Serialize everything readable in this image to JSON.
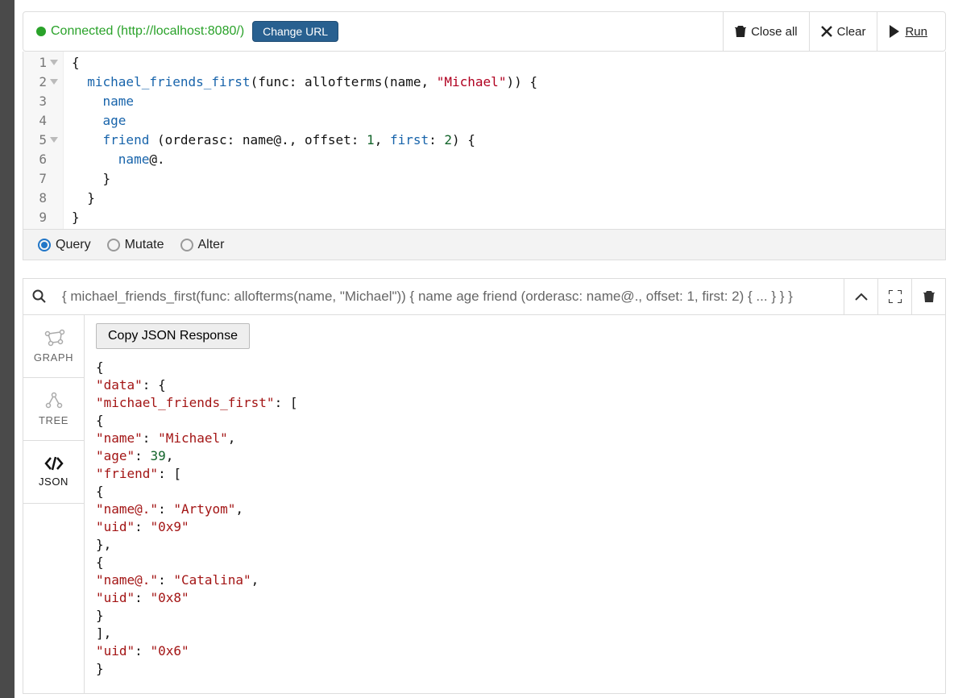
{
  "topbar": {
    "connection_label": "Connected (http://localhost:8080/)",
    "change_url_label": "Change URL",
    "close_all_label": "Close all",
    "clear_label": "Clear",
    "run_label": "Run"
  },
  "editor": {
    "lines": [
      "1",
      "2",
      "3",
      "4",
      "5",
      "6",
      "7",
      "8",
      "9"
    ],
    "code_tokens": [
      [
        {
          "t": "{",
          "c": "k-d"
        }
      ],
      [
        {
          "t": "  ",
          "c": ""
        },
        {
          "t": "michael_friends_first",
          "c": "k-blue"
        },
        {
          "t": "(func: allofterms(name, ",
          "c": "k-pl"
        },
        {
          "t": "\"Michael\"",
          "c": "k-str"
        },
        {
          "t": ")) {",
          "c": "k-pl"
        }
      ],
      [
        {
          "t": "    ",
          "c": ""
        },
        {
          "t": "name",
          "c": "k-nm"
        }
      ],
      [
        {
          "t": "    ",
          "c": ""
        },
        {
          "t": "age",
          "c": "k-nm"
        }
      ],
      [
        {
          "t": "    ",
          "c": ""
        },
        {
          "t": "friend",
          "c": "k-nm"
        },
        {
          "t": " (orderasc: name@., offset: ",
          "c": "k-pl"
        },
        {
          "t": "1",
          "c": "k-num"
        },
        {
          "t": ", ",
          "c": "k-pl"
        },
        {
          "t": "first",
          "c": "k-nm"
        },
        {
          "t": ": ",
          "c": "k-pl"
        },
        {
          "t": "2",
          "c": "k-num"
        },
        {
          "t": ") {",
          "c": "k-pl"
        }
      ],
      [
        {
          "t": "      ",
          "c": ""
        },
        {
          "t": "name",
          "c": "k-nm"
        },
        {
          "t": "@.",
          "c": "k-pl"
        }
      ],
      [
        {
          "t": "    }",
          "c": "k-d"
        }
      ],
      [
        {
          "t": "  }",
          "c": "k-d"
        }
      ],
      [
        {
          "t": "}",
          "c": "k-d"
        }
      ]
    ]
  },
  "modes": {
    "query": "Query",
    "mutate": "Mutate",
    "alter": "Alter",
    "selected": "query"
  },
  "history": {
    "summary": "{ michael_friends_first(func: allofterms(name, \"Michael\")) { name age friend (orderasc: name@., offset: 1, first: 2) { ... } } }"
  },
  "sidetabs": {
    "graph": "GRAPH",
    "tree": "TREE",
    "json": "JSON"
  },
  "result": {
    "copy_label": "Copy JSON Response",
    "json_lines": [
      [
        {
          "t": "{",
          "c": "jp"
        }
      ],
      [
        {
          "t": "  ",
          "c": ""
        },
        {
          "t": "\"data\"",
          "c": "jk"
        },
        {
          "t": ": {",
          "c": "jp"
        }
      ],
      [
        {
          "t": "    ",
          "c": ""
        },
        {
          "t": "\"michael_friends_first\"",
          "c": "jk"
        },
        {
          "t": ": [",
          "c": "jp"
        }
      ],
      [
        {
          "t": "      {",
          "c": "jp"
        }
      ],
      [
        {
          "t": "        ",
          "c": ""
        },
        {
          "t": "\"name\"",
          "c": "jk"
        },
        {
          "t": ": ",
          "c": "jp"
        },
        {
          "t": "\"Michael\"",
          "c": "js"
        },
        {
          "t": ",",
          "c": "jp"
        }
      ],
      [
        {
          "t": "        ",
          "c": ""
        },
        {
          "t": "\"age\"",
          "c": "jk"
        },
        {
          "t": ": ",
          "c": "jp"
        },
        {
          "t": "39",
          "c": "jn"
        },
        {
          "t": ",",
          "c": "jp"
        }
      ],
      [
        {
          "t": "        ",
          "c": ""
        },
        {
          "t": "\"friend\"",
          "c": "jk"
        },
        {
          "t": ": [",
          "c": "jp"
        }
      ],
      [
        {
          "t": "          {",
          "c": "jp"
        }
      ],
      [
        {
          "t": "            ",
          "c": ""
        },
        {
          "t": "\"name@.\"",
          "c": "jk"
        },
        {
          "t": ": ",
          "c": "jp"
        },
        {
          "t": "\"Artyom\"",
          "c": "js"
        },
        {
          "t": ",",
          "c": "jp"
        }
      ],
      [
        {
          "t": "            ",
          "c": ""
        },
        {
          "t": "\"uid\"",
          "c": "jk"
        },
        {
          "t": ": ",
          "c": "jp"
        },
        {
          "t": "\"0x9\"",
          "c": "js"
        }
      ],
      [
        {
          "t": "          },",
          "c": "jp"
        }
      ],
      [
        {
          "t": "          {",
          "c": "jp"
        }
      ],
      [
        {
          "t": "            ",
          "c": ""
        },
        {
          "t": "\"name@.\"",
          "c": "jk"
        },
        {
          "t": ": ",
          "c": "jp"
        },
        {
          "t": "\"Catalina\"",
          "c": "js"
        },
        {
          "t": ",",
          "c": "jp"
        }
      ],
      [
        {
          "t": "            ",
          "c": ""
        },
        {
          "t": "\"uid\"",
          "c": "jk"
        },
        {
          "t": ": ",
          "c": "jp"
        },
        {
          "t": "\"0x8\"",
          "c": "js"
        }
      ],
      [
        {
          "t": "          }",
          "c": "jp"
        }
      ],
      [
        {
          "t": "        ],",
          "c": "jp"
        }
      ],
      [
        {
          "t": "        ",
          "c": ""
        },
        {
          "t": "\"uid\"",
          "c": "jk"
        },
        {
          "t": ": ",
          "c": "jp"
        },
        {
          "t": "\"0x6\"",
          "c": "js"
        }
      ],
      [
        {
          "t": "      }",
          "c": "jp"
        }
      ]
    ]
  }
}
